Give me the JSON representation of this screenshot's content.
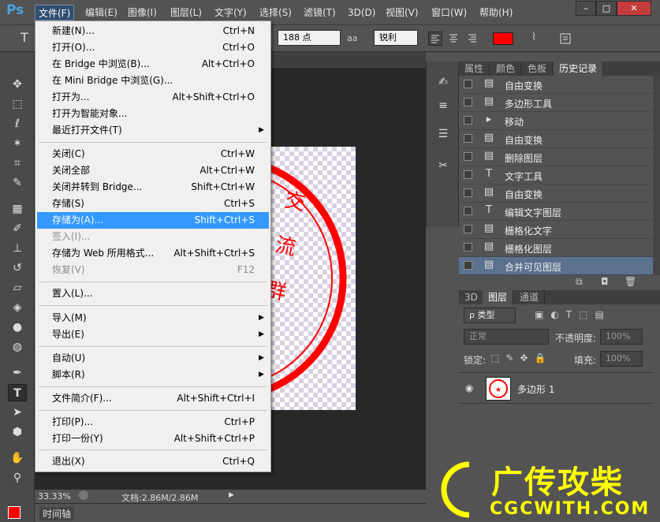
{
  "app": {
    "logo": "Ps"
  },
  "menubar": {
    "items": [
      "文件(F)",
      "编辑(E)",
      "图像(I)",
      "图层(L)",
      "文字(Y)",
      "选择(S)",
      "滤镜(T)",
      "3D(D)",
      "视图(V)",
      "窗口(W)",
      "帮助(H)"
    ],
    "window_buttons": [
      "–",
      "□",
      "✕"
    ]
  },
  "options": {
    "tool_icon": "T",
    "font_size": "188 点",
    "aa_icon": "aa",
    "aa_mode": "锐利",
    "color": "#ff0000"
  },
  "file_menu": {
    "items": [
      {
        "label": "新建(N)...",
        "shortcut": "Ctrl+N"
      },
      {
        "label": "打开(O)...",
        "shortcut": "Ctrl+O"
      },
      {
        "label": "在 Bridge 中浏览(B)...",
        "shortcut": "Alt+Ctrl+O"
      },
      {
        "label": "在 Mini Bridge 中浏览(G)...",
        "shortcut": ""
      },
      {
        "label": "打开为...",
        "shortcut": "Alt+Shift+Ctrl+O"
      },
      {
        "label": "打开为智能对象...",
        "shortcut": ""
      },
      {
        "label": "最近打开文件(T)",
        "shortcut": ""
      },
      {
        "label": "关闭(C)",
        "shortcut": "Ctrl+W"
      },
      {
        "label": "关闭全部",
        "shortcut": "Alt+Ctrl+W"
      },
      {
        "label": "关闭并转到 Bridge...",
        "shortcut": "Shift+Ctrl+W"
      },
      {
        "label": "存储(S)",
        "shortcut": "Ctrl+S"
      },
      {
        "label": "存储为(A)...",
        "shortcut": "Shift+Ctrl+S"
      },
      {
        "label": "签入(I)...",
        "shortcut": ""
      },
      {
        "label": "存储为 Web 所用格式...",
        "shortcut": "Alt+Shift+Ctrl+S"
      },
      {
        "label": "恢复(V)",
        "shortcut": "F12"
      },
      {
        "label": "置入(L)...",
        "shortcut": ""
      },
      {
        "label": "导入(M)",
        "shortcut": ""
      },
      {
        "label": "导出(E)",
        "shortcut": ""
      },
      {
        "label": "自动(U)",
        "shortcut": ""
      },
      {
        "label": "脚本(R)",
        "shortcut": ""
      },
      {
        "label": "文件简介(F)...",
        "shortcut": "Alt+Shift+Ctrl+I"
      },
      {
        "label": "打印(P)...",
        "shortcut": "Ctrl+P"
      },
      {
        "label": "打印一份(Y)",
        "shortcut": "Alt+Shift+Ctrl+P"
      },
      {
        "label": "退出(X)",
        "shortcut": "Ctrl+Q"
      }
    ],
    "submenu_arrow": "▶"
  },
  "history_panel": {
    "tabs": [
      "属性",
      "颜色",
      "色板",
      "历史记录"
    ],
    "rows": [
      "自由变换",
      "多边形工具",
      "移动",
      "自由变换",
      "删除图层",
      "文字工具",
      "自由变换",
      "编辑文字图层",
      "栅格化文字",
      "栅格化图层",
      "合并可见图层"
    ]
  },
  "layers_panel": {
    "tabs": [
      "3D",
      "图层",
      "通道"
    ],
    "filter": "ρ 类型",
    "blend_mode": "正常",
    "opacity_label": "不透明度:",
    "opacity": "100%",
    "lock_label": "锁定:",
    "fill_label": "填充:",
    "fill": "100%",
    "layer_name": "多边形 1"
  },
  "canvas": {
    "seal_text": "交流群"
  },
  "status": {
    "zoom": "33.33%",
    "doc": "文档:2.86M/2.86M"
  },
  "timeline": {
    "label": "时间轴"
  },
  "watermark": {
    "cn": "广传攻柴",
    "en": "CGCWITH.COM"
  },
  "colors": {
    "accent": "#3399ff",
    "seal_red": "#ff0000",
    "watermark_yellow": "#ffff00"
  }
}
